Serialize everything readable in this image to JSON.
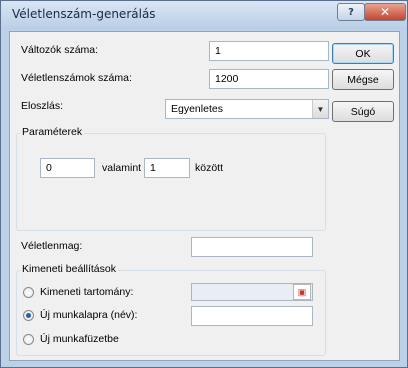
{
  "window": {
    "title": "Véletlenszám-generálás"
  },
  "titlebar_buttons": {
    "help_label": "?",
    "close_label": "✕"
  },
  "form": {
    "num_variables_label": "Változók száma:",
    "num_variables_value": "1",
    "num_random_label": "Véletlenszámok száma:",
    "num_random_value": "1200",
    "distribution_label": "Eloszlás:",
    "distribution_value": "Egyenletes",
    "parameters_title": "Paraméterek",
    "param_from_value": "0",
    "param_between_label": "valamint",
    "param_to_value": "1",
    "param_between_suffix": "között",
    "seed_label": "Véletlenmag:",
    "seed_value": ""
  },
  "buttons": {
    "ok": "OK",
    "cancel": "Mégse",
    "help": "Súgó"
  },
  "output": {
    "title": "Kimeneti beállítások",
    "options": [
      {
        "label": "Kimeneti tartomány:",
        "checked": false
      },
      {
        "label": "Új munkalapra (név):",
        "checked": true
      },
      {
        "label": "Új munkafüzetbe",
        "checked": false
      }
    ],
    "range_value": "",
    "sheet_name_value": ""
  },
  "icons": {
    "refedit": "range-select-icon",
    "dropdown": "chevron-down-icon"
  },
  "colors": {
    "accent": "#3c7fb1",
    "titlebar": "#c7d8ec"
  }
}
